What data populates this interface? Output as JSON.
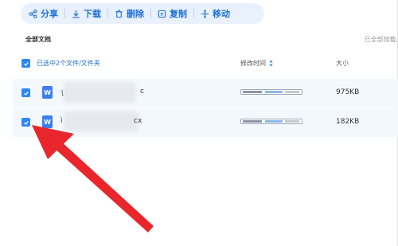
{
  "toolbar": {
    "share_label": "分享",
    "download_label": "下载",
    "delete_label": "删除",
    "copy_label": "复制",
    "move_label": "移动"
  },
  "section": {
    "title": "全部文档",
    "loaded_hint": "已全部加载,"
  },
  "table": {
    "selection_label": "已选中2个文件/文件夹",
    "col_mtime": "修改时间",
    "col_size": "大小",
    "rows": [
      {
        "name_start": "讠",
        "name_end": "c",
        "size": "975KB",
        "selected": true
      },
      {
        "name_start": "ì",
        "name_end": "cx",
        "size": "182KB",
        "selected": true
      }
    ]
  },
  "colors": {
    "accent": "#2f86f6",
    "toolbar_bg": "#e8f1fc",
    "row_bg": "#f3f8fe",
    "arrow": "#e8262b"
  },
  "icons": {
    "doc_icon_letter": "W"
  }
}
